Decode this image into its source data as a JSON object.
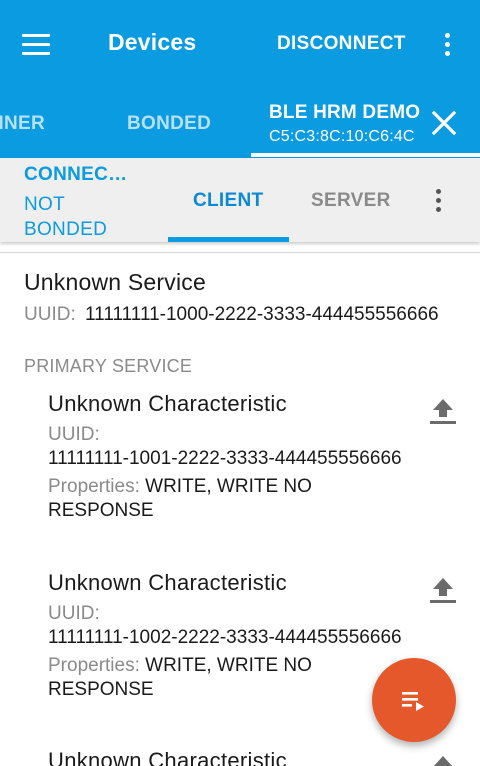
{
  "appbar": {
    "title": "Devices",
    "disconnect_label": "DISCONNECT",
    "menu_icon": "hamburger-menu-icon",
    "overflow_icon": "more-vert-icon",
    "color": "#0a9be0"
  },
  "device_tabs": {
    "scanner_label": "NNER",
    "bonded_label": "BONDED",
    "active": {
      "name": "BLE HRM DEMO",
      "address": "C5:C3:8C:10:C6:4C"
    },
    "close_icon": "close-icon"
  },
  "sub_tabs": {
    "connection_state": "CONNEC…",
    "bond_state": "NOT BONDED",
    "client_label": "CLIENT",
    "server_label": "SERVER",
    "accent_color": "#0a9be0"
  },
  "service": {
    "name": "Unknown Service",
    "uuid_label": "UUID:",
    "uuid": "11111111-1000-2222-3333-444455556666",
    "type": "PRIMARY SERVICE"
  },
  "characteristics": [
    {
      "name": "Unknown Characteristic",
      "uuid_label": "UUID:",
      "uuid": "11111111-1001-2222-3333-444455556666",
      "properties_label": "Properties:",
      "properties": "WRITE, WRITE NO RESPONSE",
      "action_icon": "upload-icon"
    },
    {
      "name": "Unknown Characteristic",
      "uuid_label": "UUID:",
      "uuid": "11111111-1002-2222-3333-444455556666",
      "properties_label": "Properties:",
      "properties": "WRITE, WRITE NO RESPONSE",
      "action_icon": "upload-icon"
    },
    {
      "name": "Unknown Characteristic",
      "action_icon": "upload-icon"
    }
  ],
  "fab": {
    "icon": "playlist-play-icon",
    "color": "#e4582c"
  }
}
